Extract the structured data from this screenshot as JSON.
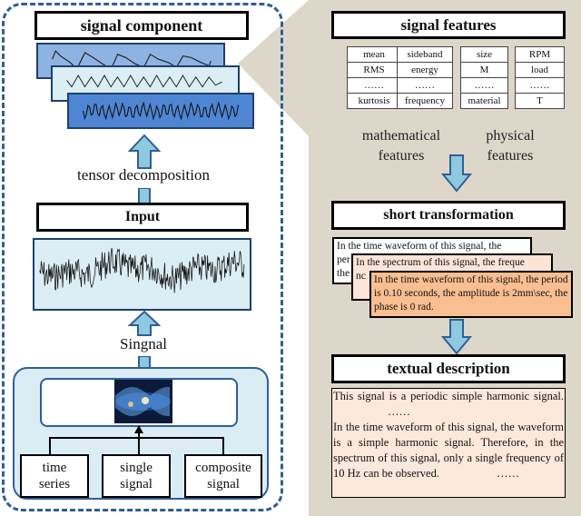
{
  "left_panel": {
    "signal_component_title": "signal component",
    "tensor_label": "tensor decomposition",
    "input_title": "Input",
    "signal_label": "Singnal",
    "sources": [
      {
        "line1": "time",
        "line2": "series"
      },
      {
        "line1": "single",
        "line2": "signal"
      },
      {
        "line1": "composite",
        "line2": "signal"
      }
    ]
  },
  "right_panel": {
    "features_title": "signal features",
    "feature_tables": [
      [
        "mean",
        "RMS",
        "……",
        "kurtosis"
      ],
      [
        "sideband",
        "energy",
        "……",
        "frequency"
      ],
      [
        "size",
        "M",
        "……",
        "material"
      ],
      [
        "RPM",
        "load",
        "……",
        "T"
      ]
    ],
    "math_caption": {
      "line1": "mathematical",
      "line2": "features"
    },
    "phys_caption": {
      "line1": "physical",
      "line2": "features"
    },
    "short_title": "short transformation",
    "cards": [
      "In the time waveform of this signal, the period ... the ...",
      "In the spectrum of this signal, the freque ncy ...",
      "In the time waveform of this signal, the period is 0.10 seconds, the amplitude is 2mm\\sec, the phase is 0 rad."
    ],
    "card1_visible": {
      "line1": "In the time waveform of this signal, the",
      "line2": "per",
      "line3": "the"
    },
    "card2_visible": {
      "line1": "In the spectrum of this signal, the freque",
      "line2": "nc"
    },
    "textual_title": "textual description",
    "description": {
      "p1": "This signal is a periodic simple harmonic signal.",
      "ellipsis1": "……",
      "p2": "In the time waveform of this signal, the waveform is a simple harmonic signal. Therefore, in the spectrum of this signal, only a single frequency of 10 Hz can be observed.",
      "ellipsis2": "……"
    }
  },
  "colors": {
    "beige_panel": "#ddd7ca",
    "dashed_border": "#2f5f95",
    "arrow_fill": "#8fc9e0",
    "wave_blue_1": "#8db3e2",
    "wave_blue_2": "#dbeef4",
    "wave_blue_3": "#4f86d4",
    "card_peach_light": "#fce4d6",
    "card_peach": "#f9bf91"
  }
}
